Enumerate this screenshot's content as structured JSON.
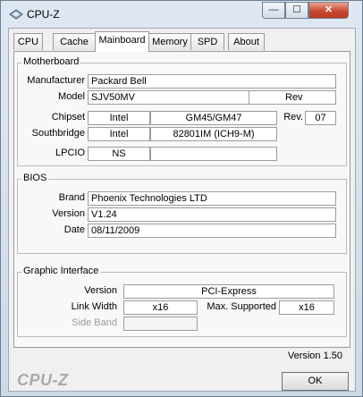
{
  "window": {
    "title": "CPU-Z",
    "minimize_glyph": "—",
    "maximize_glyph": "☐",
    "close_glyph": "✕"
  },
  "tabs": [
    {
      "label": "CPU"
    },
    {
      "label": "Cache"
    },
    {
      "label": "Mainboard"
    },
    {
      "label": "Memory"
    },
    {
      "label": "SPD"
    },
    {
      "label": "About"
    }
  ],
  "active_tab": "Mainboard",
  "motherboard": {
    "legend": "Motherboard",
    "manufacturer_label": "Manufacturer",
    "manufacturer": "Packard Bell",
    "model_label": "Model",
    "model": "SJV50MV",
    "model_rev": "Rev",
    "chipset_label": "Chipset",
    "chipset_vendor": "Intel",
    "chipset_model": "GM45/GM47",
    "chipset_rev_label": "Rev.",
    "chipset_rev": "07",
    "southbridge_label": "Southbridge",
    "southbridge_vendor": "Intel",
    "southbridge_model": "82801IM (ICH9-M)",
    "lpcio_label": "LPCIO",
    "lpcio_vendor": "NS",
    "lpcio_model": ""
  },
  "bios": {
    "legend": "BIOS",
    "brand_label": "Brand",
    "brand": "Phoenix Technologies LTD",
    "version_label": "Version",
    "version": "V1.24",
    "date_label": "Date",
    "date": "08/11/2009"
  },
  "graphic": {
    "legend": "Graphic Interface",
    "version_label": "Version",
    "version": "PCI-Express",
    "link_width_label": "Link Width",
    "link_width": "x16",
    "max_supported_label": "Max. Supported",
    "max_supported": "x16",
    "side_band_label": "Side Band",
    "side_band": ""
  },
  "footer": {
    "version_text": "Version 1.50",
    "brand_text": "CPU-Z",
    "ok_label": "OK"
  }
}
